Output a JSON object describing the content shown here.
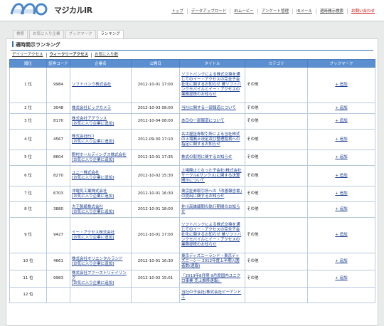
{
  "brand": {
    "name": "マジカルIR"
  },
  "topnav": [
    {
      "label": "トップ"
    },
    {
      "label": "データアップロード"
    },
    {
      "label": "IRムービー"
    },
    {
      "label": "アンケート管理"
    },
    {
      "label": "IRメール"
    },
    {
      "label": "適時開示検索"
    },
    {
      "label": "お問い合わせ"
    }
  ],
  "tabs": [
    {
      "label": "検索"
    },
    {
      "label": "お気に入り企業"
    },
    {
      "label": "ブックマーク"
    },
    {
      "label": "ランキング"
    }
  ],
  "panel": {
    "title": "適時開示ランキング"
  },
  "subnav": [
    {
      "label": "デイリーアクセス"
    },
    {
      "label": "ウィークリーアクセス"
    },
    {
      "label": "お気に入り数"
    }
  ],
  "table": {
    "headers": [
      "順位",
      "証券コード",
      "企業名",
      "公開日",
      "タイトル",
      "カテゴリ",
      "ブックマーク"
    ],
    "fav_label": "[お気に入り企業に追加]",
    "add_label": "+ 追加",
    "rows": [
      {
        "rank": "1 位",
        "code": "9984",
        "company": "ソフトバンク株式会社",
        "fav": false,
        "date": "2012-10-01 17:00",
        "title": "ソフトバンクによる株式交換を通じてのイー・アクセスの完全子会社化に関するお知らせ 兼ソフトバンクモバイルとイー・アクセスの業務提携のお知らせ",
        "category": "その他"
      },
      {
        "rank": "2 位",
        "code": "3048",
        "company": "株式会社ビックカメラ",
        "fav": false,
        "date": "2012-10-03 08:00",
        "title": "当社に関する一部報道について",
        "category": "その他"
      },
      {
        "rank": "3 位",
        "code": "8170",
        "company": "株式会社アデランス",
        "fav": true,
        "date": "2012-10-04 08:00",
        "title": "本日の一部報道について",
        "category": "その他"
      },
      {
        "rank": "4 位",
        "code": "4567",
        "company": "株式会社ECI",
        "fav": true,
        "date": "2012-09-30 17:10",
        "title": "名古屋証券取引所による当社株式の上場廃止決定及び整理銘柄への指定に関するお知らせ",
        "category": "その他"
      },
      {
        "rank": "5 位",
        "code": "8604",
        "company": "野村ホールディングス株式会社",
        "fav": true,
        "date": "2012-10-01 17:35",
        "title": "株式の取得に関するお知らせ",
        "category": "その他"
      },
      {
        "rank": "6 位",
        "code": "8270",
        "company": "ユニー株式会社",
        "fav": true,
        "date": "2012-10-02 15:30",
        "title": "上場廃止となった子会社(株式会社サークルKサンクス)に関する決算開示について",
        "category": "その他"
      },
      {
        "rank": "7 位",
        "code": "6703",
        "company": "沖電気工業株式会社",
        "fav": true,
        "date": "2012-10-01 16:30",
        "title": "東京証券取引所への「改善報告書」の提出に関するお知らせ",
        "category": "その他"
      },
      {
        "rank": "8 位",
        "code": "3880",
        "company": "大王製紙株式会社",
        "fav": true,
        "date": "2012-10-01 18:00",
        "title": "井川高雄顧問の執行期間のお知らせ",
        "category": "その他"
      },
      {
        "rank": "9 位",
        "code": "9427",
        "company": "イー・アクセス株式会社",
        "fav": true,
        "date": "2012-10-01 17:00",
        "title": "ソフトバンクによる株式交換を通じてのイー・アクセスの完全子会社化に関するお知らせ 兼ソフトバンクモバイルとイー・アクセスの業務提携のお知らせ",
        "category": "その他"
      },
      {
        "rank": "10 位",
        "code": "4661",
        "company": "株式会社オリエンタルランド",
        "fav": true,
        "date": "2012-10-01 16:30",
        "title": "東京ディズニーランド・東京ディズニーシー 2012年度上半期入園者数(速報)",
        "category": "その他"
      },
      {
        "rank": "11 位",
        "code": "9983",
        "company": "株式会社ファーストリテイリング",
        "fav": true,
        "date": "2012-10-02 15:01",
        "title": "「2013年8月期 9月度国内ユニクロ事業 売上推移速報」",
        "category": "その他"
      },
      {
        "rank": "12 位",
        "code": "",
        "company": "",
        "fav": false,
        "date": "",
        "title": "当社の子会社(株式会社ピーアンドエ",
        "category": ""
      }
    ]
  }
}
